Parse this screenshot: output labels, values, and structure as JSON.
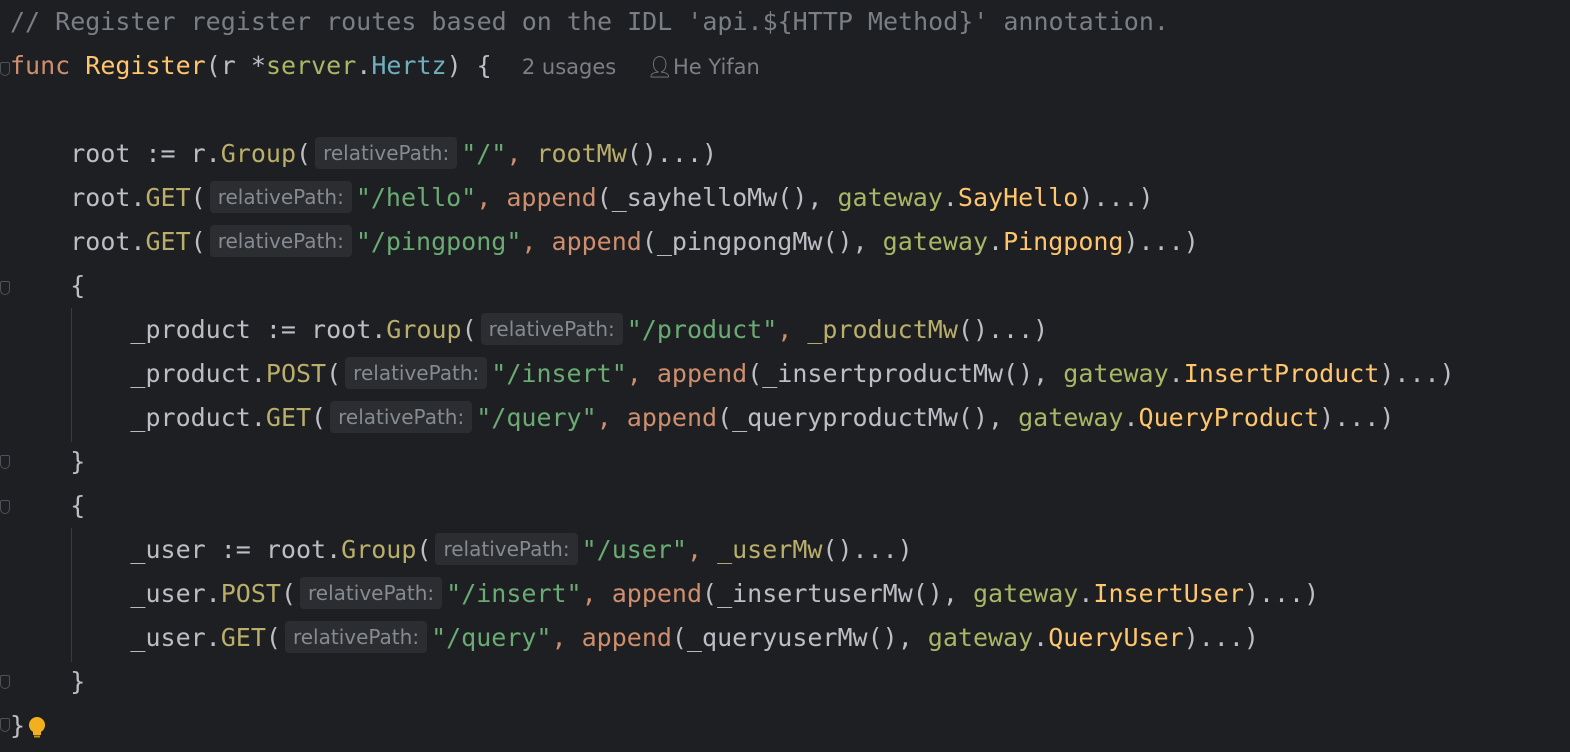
{
  "comment": "// Register register routes based on the IDL 'api.${HTTP Method}' annotation.",
  "func_decl": {
    "keyword": "func",
    "name": "Register",
    "open": "(",
    "param": "r",
    "star": " *",
    "pkg": "server",
    "dot": ".",
    "type": "Hertz",
    "close": ") {",
    "usages": "2 usages",
    "author": "He Yifan"
  },
  "hint_label": "relativePath:",
  "lines": {
    "root_group": {
      "a": "root := r.",
      "fn": "Group",
      "paren": "(",
      "str": "\"/\"",
      "comma": ", ",
      "mw": "rootMw",
      "tail": "()...)"
    },
    "root_hello": {
      "a": "root.",
      "fn": "GET",
      "paren": "(",
      "str": "\"/hello\"",
      "comma": ", ",
      "app": "append",
      "mw": "(_sayhelloMw(), ",
      "gw": "gateway",
      "dot": ".",
      "gwfn": "SayHello",
      "tail": ")...)"
    },
    "root_ping": {
      "a": "root.",
      "fn": "GET",
      "paren": "(",
      "str": "\"/pingpong\"",
      "comma": ", ",
      "app": "append",
      "mw": "(_pingpongMw(), ",
      "gw": "gateway",
      "dot": ".",
      "gwfn": "Pingpong",
      "tail": ")...)"
    },
    "open1": "{",
    "product_group": {
      "a": "_product := root.",
      "fn": "Group",
      "paren": "(",
      "str": "\"/product\"",
      "comma": ", ",
      "mw": "_productMw",
      "tail": "()...)"
    },
    "product_post": {
      "a": "_product.",
      "fn": "POST",
      "paren": "(",
      "str": "\"/insert\"",
      "comma": ", ",
      "app": "append",
      "mw": "(_insertproductMw(), ",
      "gw": "gateway",
      "dot": ".",
      "gwfn": "InsertProduct",
      "tail": ")...)"
    },
    "product_get": {
      "a": "_product.",
      "fn": "GET",
      "paren": "(",
      "str": "\"/query\"",
      "comma": ", ",
      "app": "append",
      "mw": "(_queryproductMw(), ",
      "gw": "gateway",
      "dot": ".",
      "gwfn": "QueryProduct",
      "tail": ")...)"
    },
    "close1": "}",
    "open2": "{",
    "user_group": {
      "a": "_user := root.",
      "fn": "Group",
      "paren": "(",
      "str": "\"/user\"",
      "comma": ", ",
      "mw": "_userMw",
      "tail": "()...)"
    },
    "user_post": {
      "a": "_user.",
      "fn": "POST",
      "paren": "(",
      "str": "\"/insert\"",
      "comma": ", ",
      "app": "append",
      "mw": "(_insertuserMw(), ",
      "gw": "gateway",
      "dot": ".",
      "gwfn": "InsertUser",
      "tail": ")...)"
    },
    "user_get": {
      "a": "_user.",
      "fn": "GET",
      "paren": "(",
      "str": "\"/query\"",
      "comma": ", ",
      "app": "append",
      "mw": "(_queryuserMw(), ",
      "gw": "gateway",
      "dot": ".",
      "gwfn": "QueryUser",
      "tail": ")...)"
    },
    "close2": "}",
    "close_func": "}"
  },
  "icons": {
    "bulb": "lightbulb-icon",
    "author": "person-icon",
    "fold": "fold-marker-icon"
  },
  "colors": {
    "background": "#1e1f22",
    "keyword": "#cf8e6d",
    "function": "#ffc66d",
    "string": "#6aab73",
    "comment": "#7a7e85"
  }
}
